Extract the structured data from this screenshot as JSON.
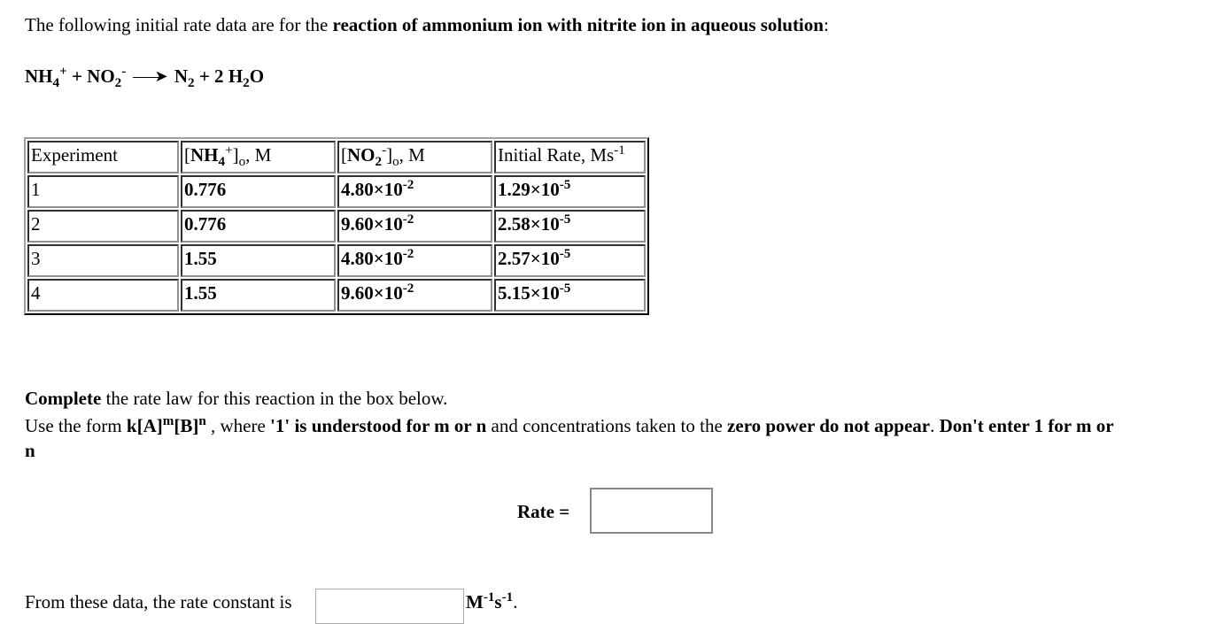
{
  "intro": {
    "prefix": "The following initial rate data are for the ",
    "bold": "reaction of ammonium ion with nitrite ion in aqueous solution",
    "suffix": ":"
  },
  "equation": {
    "r1_base": "NH",
    "r1_sub": "4",
    "r1_sup": "+",
    "plus1": " + ",
    "r2_base": "NO",
    "r2_sub": "2",
    "r2_sup": "-",
    "p1_base": "N",
    "p1_sub": "2",
    "plus2": " + 2 ",
    "p2_base": "H",
    "p2_sub": "2",
    "p2_tail": "O"
  },
  "table": {
    "headers": {
      "experiment": "Experiment",
      "nh4_open": "[",
      "nh4_base": "NH",
      "nh4_sub": "4",
      "nh4_sup": "+",
      "nh4_close": "]",
      "nh4_o": "o",
      "nh4_unit": ", M",
      "no2_open": "[",
      "no2_base": "NO",
      "no2_sub": "2",
      "no2_sup": "-",
      "no2_close": "]",
      "no2_o": "o",
      "no2_unit": ", M",
      "rate_text": "Initial Rate, Ms",
      "rate_sup": "-1"
    },
    "rows": [
      {
        "experiment": "1",
        "nh4": "0.776",
        "no2_mant": "4.80×10",
        "no2_exp": "-2",
        "rate_mant": "1.29×10",
        "rate_exp": "-5"
      },
      {
        "experiment": "2",
        "nh4": "0.776",
        "no2_mant": "9.60×10",
        "no2_exp": "-2",
        "rate_mant": "2.58×10",
        "rate_exp": "-5"
      },
      {
        "experiment": "3",
        "nh4": "1.55",
        "no2_mant": "4.80×10",
        "no2_exp": "-2",
        "rate_mant": "2.57×10",
        "rate_exp": "-5"
      },
      {
        "experiment": "4",
        "nh4": "1.55",
        "no2_mant": "9.60×10",
        "no2_exp": "-2",
        "rate_mant": "5.15×10",
        "rate_exp": "-5"
      }
    ]
  },
  "instructions": {
    "complete_bold": "Complete",
    "complete_rest": " the rate law for this reaction in the box below.",
    "use_prefix": "Use the form ",
    "form_k": "k[A]",
    "form_m": "m",
    "form_b": "[B]",
    "form_n": "n",
    "where": " , where ",
    "understood_bold": "'1' is understood for m or n",
    "and_conc": " and concentrations taken to the ",
    "zero_bold": "zero power do not appear",
    "period": ". ",
    "dont_bold": "Don't enter 1 for m or",
    "line2_bold": "n"
  },
  "rate_law": {
    "label": "Rate =",
    "value": ""
  },
  "rate_constant": {
    "label": "From these data, the rate constant is ",
    "value": "",
    "unit_m": "M",
    "unit_m_exp": "-1",
    "unit_s": "s",
    "unit_s_exp": "-1",
    "end": "."
  }
}
